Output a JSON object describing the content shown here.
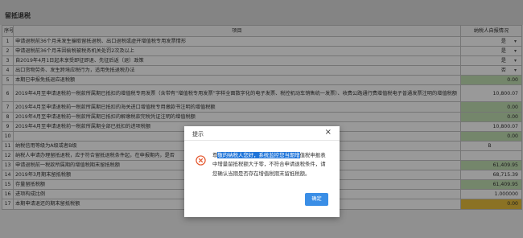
{
  "section_title": "留抵退税",
  "table": {
    "headers": {
      "no": "序号",
      "item": "项目",
      "status": "纳税人自报情况"
    },
    "rows": [
      {
        "no": "1",
        "item": "申请退税前36个月未发生骗取留抵退税、出口退税或虚开增值税专用发票情形",
        "value": "是",
        "kind": "select"
      },
      {
        "no": "2",
        "item": "申请退税前36个月未因偷税被税务机关处罚2次及以上",
        "value": "是",
        "kind": "select"
      },
      {
        "no": "3",
        "item": "自2019年4月1日起未享受即征即退、先征后返（退）政策",
        "value": "是",
        "kind": "select"
      },
      {
        "no": "4",
        "item": "出口货物劳务、发生跨境应税行为，适用免抵退税办法",
        "value": "否",
        "kind": "select"
      },
      {
        "no": "5",
        "item": "本期已申报免抵退应退税额",
        "value": "0.00",
        "kind": "green"
      },
      {
        "no": "6",
        "item": "2019年4月至申请退税前一税款所属期已抵扣的增值税专用发票（含带有“增值税专用发票”字样全面数字化的电子发票、税控机动车销售统一发票）、收费公路通行费增值税电子普通发票注明的增值税额",
        "value": "10,800.07",
        "kind": "plain",
        "tall": true
      },
      {
        "no": "7",
        "item": "2019年4月至申请退税前一税款所属期已抵扣的海关进口增值税专用缴款书注明的增值税额",
        "value": "0.00",
        "kind": "green"
      },
      {
        "no": "8",
        "item": "2019年4月至申请退税前一税款所属期已抵扣的解缴税款完税凭证注明的增值税额",
        "value": "0.00",
        "kind": "green"
      },
      {
        "no": "9",
        "item": "2019年4月至申请退税前一税款所属期全部已抵扣的进项税额",
        "value": "10,800.07",
        "kind": "plain"
      },
      {
        "no": "10",
        "item": "",
        "value": "0.00",
        "kind": "green"
      },
      {
        "no": "11",
        "item": "纳税信用等级为A级或者B级",
        "value": "B",
        "kind": "selectlite"
      },
      {
        "no": "12",
        "item": "纳税人申请办理留抵退税，应于符合留抵退税条件起，在申报期内，是否",
        "value": "",
        "kind": "selectlite"
      },
      {
        "no": "13",
        "item": "申请退税前一税款所属期的增值税期末留抵税额",
        "value": "61,409.95",
        "kind": "green"
      },
      {
        "no": "14",
        "item": "2019年3月期末留抵税额",
        "value": "68,715.39",
        "kind": "plain"
      },
      {
        "no": "15",
        "item": "存量留抵税额",
        "value": "61,409.95",
        "kind": "green"
      },
      {
        "no": "16",
        "item": "进项构成比例",
        "value": "1.000000",
        "kind": "plain"
      },
      {
        "no": "17",
        "item": "本期申请退还的期末留抵税额",
        "value": "0.00",
        "kind": "yellow"
      }
    ]
  },
  "dialog": {
    "title": "提示",
    "close": "×",
    "msg_lead": "尊",
    "msg_highlight": "敬的纳税人您好，系统监控您当期增",
    "msg_rest": "值税申报表中增量留抵税额大于零，不符合申请退税条件，请您确认当期是否存在增值税期末留抵税额。",
    "ok_label": "确定",
    "icon": "error-circle-x-icon"
  },
  "colors": {
    "green": "#bcd8ad",
    "yellow": "#e0b83a",
    "accent": "#3a8ee6",
    "warn": "#e4572e"
  }
}
